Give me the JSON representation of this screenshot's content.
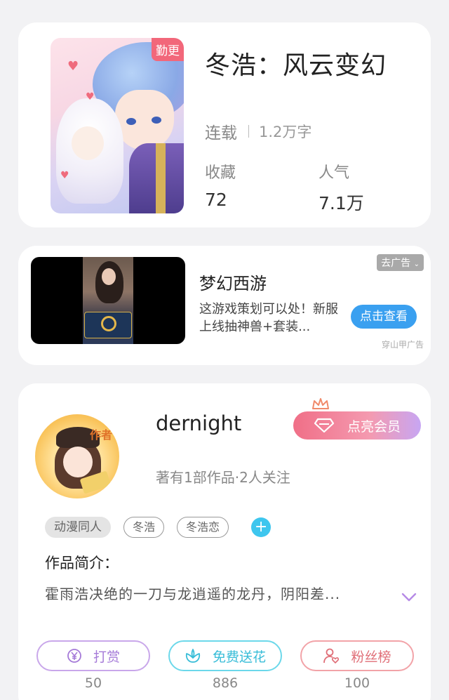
{
  "book": {
    "badge": "勤更",
    "title": "冬浩：风云变幻",
    "status": "连载",
    "word_count": "1.2万字",
    "favorites_label": "收藏",
    "favorites_value": "72",
    "popularity_label": "人气",
    "popularity_value": "7.1万"
  },
  "ad": {
    "close_label": "去广告",
    "title": "梦幻西游",
    "description": "这游戏策划可以处！新服上线抽神兽+套装...",
    "button_label": "点击查看",
    "source": "穿山甲广告"
  },
  "author": {
    "name": "dernight",
    "avatar_tag": "作者",
    "meta": "著有1部作品·2人关注",
    "vip_button": "点亮会员",
    "tags": [
      "动漫同人",
      "冬浩",
      "冬浩恋"
    ],
    "intro_label": "作品简介：",
    "intro_text": "霍雨浩决绝的一刀与龙逍遥的龙丹，阴阳差..."
  },
  "actions": {
    "reward_label": "打赏",
    "reward_count": "50",
    "flower_label": "免费送花",
    "flower_count": "886",
    "fans_label": "粉丝榜",
    "fans_count": "100"
  },
  "colors": {
    "badge": "#f2677a",
    "ad_button": "#3aa0f0",
    "tag_add": "#3ec6ee",
    "reward": "#a57ad8",
    "flower": "#38bdd8",
    "fans": "#e06f78"
  }
}
